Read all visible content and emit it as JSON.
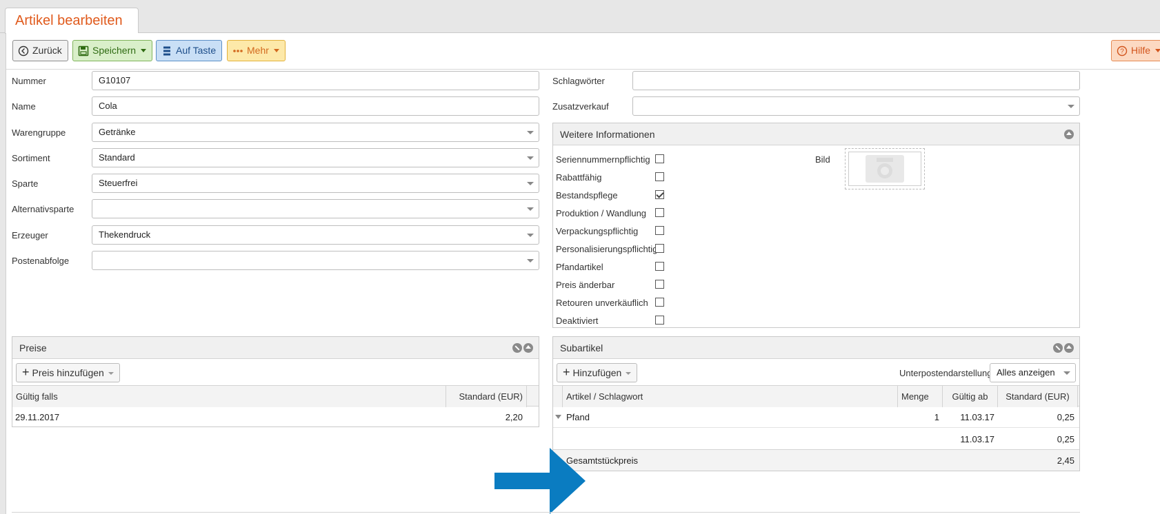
{
  "tab": {
    "title": "Artikel bearbeiten"
  },
  "toolbar": {
    "back_label": "Zurück",
    "save_label": "Speichern",
    "key_label": "Auf Taste",
    "more_label": "Mehr",
    "help_label": "Hilfe"
  },
  "form": {
    "nummer_label": "Nummer",
    "nummer_value": "G10107",
    "name_label": "Name",
    "name_value": "Cola",
    "warengruppe_label": "Warengruppe",
    "warengruppe_value": "Getränke",
    "sortiment_label": "Sortiment",
    "sortiment_value": "Standard",
    "sparte_label": "Sparte",
    "sparte_value": "Steuerfrei",
    "alternativsparte_label": "Alternativsparte",
    "alternativsparte_value": "",
    "erzeuger_label": "Erzeuger",
    "erzeuger_value": "Thekendruck",
    "postenabfolge_label": "Postenabfolge",
    "postenabfolge_value": "",
    "schlagwoerter_label": "Schlagwörter",
    "schlagwoerter_value": "",
    "zusatzverkauf_label": "Zusatzverkauf",
    "zusatzverkauf_value": ""
  },
  "info": {
    "title": "Weitere Informationen",
    "bild_label": "Bild",
    "checks": [
      {
        "label": "Seriennummernpflichtig",
        "checked": false
      },
      {
        "label": "Rabattfähig",
        "checked": false
      },
      {
        "label": "Bestandspflege",
        "checked": true
      },
      {
        "label": "Produktion / Wandlung",
        "checked": false
      },
      {
        "label": "Verpackungspflichtig",
        "checked": false
      },
      {
        "label": "Personalisierungspflichtig",
        "checked": false
      },
      {
        "label": "Pfandartikel",
        "checked": false
      },
      {
        "label": "Preis änderbar",
        "checked": false
      },
      {
        "label": "Retouren unverkäuflich",
        "checked": false
      },
      {
        "label": "Deaktiviert",
        "checked": false
      }
    ]
  },
  "preise": {
    "title": "Preise",
    "add_label": "Preis hinzufügen",
    "col_valid": "Gültig falls",
    "col_std": "Standard (EUR)",
    "rows": [
      {
        "valid": "29.11.2017",
        "std": "2,20"
      }
    ]
  },
  "sub": {
    "title": "Subartikel",
    "add_label": "Hinzufügen",
    "display_label": "Unterpostendarstellung",
    "display_value": "Alles anzeigen",
    "col_art": "Artikel / Schlagwort",
    "col_menge": "Menge",
    "col_gueltig": "Gültig ab",
    "col_std": "Standard (EUR)",
    "rows": [
      {
        "art": "Pfand",
        "menge": "1",
        "gueltig": "11.03.17",
        "std": "0,25"
      },
      {
        "art": "",
        "menge": "",
        "gueltig": "11.03.17",
        "std": "0,25"
      }
    ],
    "total_label": "Gesamtstückpreis",
    "total_value": "2,45"
  },
  "colors": {
    "accent": "#e05a1c",
    "arrow": "#0a7cc1"
  }
}
